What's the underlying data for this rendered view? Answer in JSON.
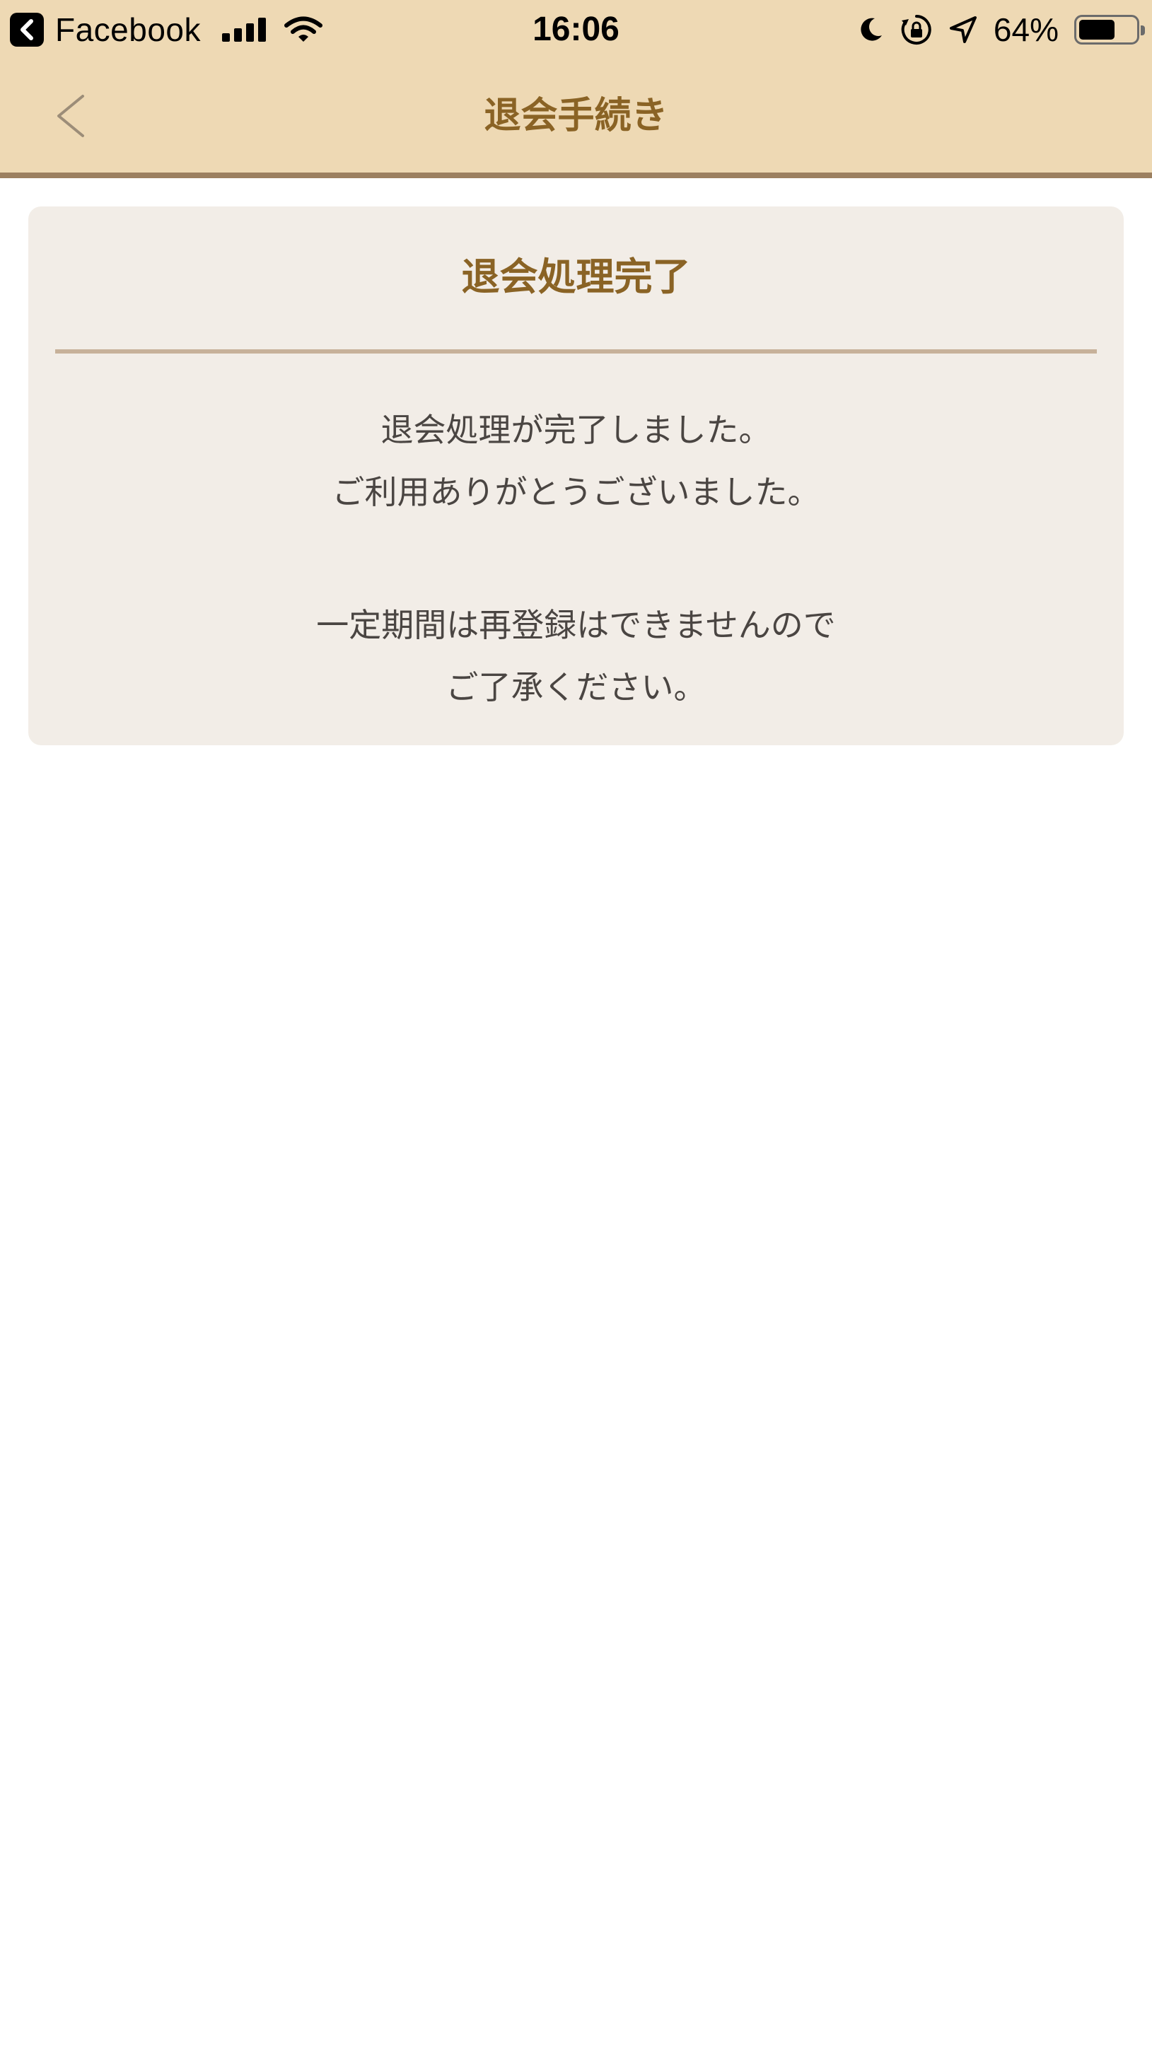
{
  "status_bar": {
    "app_name": "Facebook",
    "time": "16:06",
    "battery_percent": "64%",
    "battery_level": 0.64
  },
  "nav": {
    "title": "退会手続き"
  },
  "card": {
    "title": "退会処理完了",
    "lines_group_1": [
      "退会処理が完了しました。",
      "ご利用ありがとうございました。"
    ],
    "lines_group_2": [
      "一定期間は再登録はできませんので",
      "ご了承ください。"
    ]
  },
  "colors": {
    "header_bg": "#eed9b4",
    "header_border": "#9c8060",
    "title_brown": "#8a6325",
    "card_bg": "#f2ede7",
    "divider": "#c7b19a",
    "body_text": "#4a4542"
  }
}
